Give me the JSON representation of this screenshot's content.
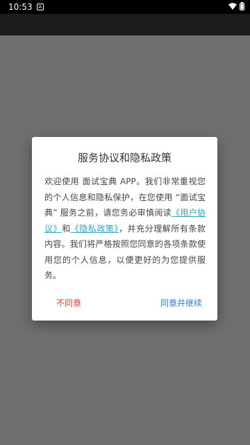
{
  "status_bar": {
    "time": "10:53",
    "notification_icon": "A",
    "icons": [
      "wifi-icon",
      "battery-icon"
    ]
  },
  "dialog": {
    "title": "服务协议和隐私政策",
    "body_part1": "欢迎使用 面试宝典 APP。我们非常重视您的个人信息和隐私保护，在您使用 “面试宝典” 服务之前，请您务必审慎阅读",
    "user_agreement_link": "《用户协议》",
    "and_text": "和",
    "privacy_policy_link": "《隐私政策》",
    "body_part2": "，并充分理解所有条款内容。我们将严格按照您同意的各项条款使用您的个人信息，以便更好的为您提供服务。",
    "disagree_label": "不同意",
    "agree_label": "同意并继续",
    "colors": {
      "link": "#2aa7c9",
      "disagree": "#e03c31",
      "agree": "#2a7fd4"
    }
  }
}
